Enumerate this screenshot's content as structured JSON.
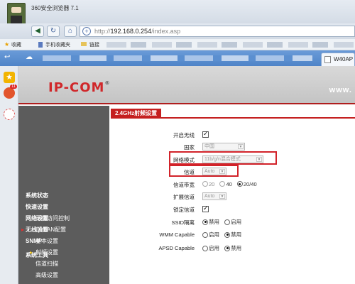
{
  "browser": {
    "title": "360安全浏览器 7.1",
    "url_prefix": "http://",
    "url_host": "192.168.0.254",
    "url_path": "/index.asp",
    "bookmarks_label": "收藏",
    "bookmark_mobile": "手机收藏夹",
    "bookmark_link": "链接",
    "active_tab": "W40AP",
    "weibo_badge": "11"
  },
  "router": {
    "logo": "IP-COM",
    "logo_tm": "®",
    "site_text": "www."
  },
  "menu": {
    "items": [
      {
        "label": "系统状态"
      },
      {
        "label": "快速设置"
      },
      {
        "label": "网络设置"
      },
      {
        "label": "无线设置"
      },
      {
        "label": "基本设置"
      },
      {
        "label": "射频设置"
      },
      {
        "label": "信道扫描"
      },
      {
        "label": "高级设置"
      },
      {
        "label": "无线访问控制"
      },
      {
        "label": "QVLAN配置"
      },
      {
        "label": "SNMP"
      },
      {
        "label": "系统工具"
      }
    ]
  },
  "rf_settings": {
    "section_title": "2.4GHz射频设置",
    "enable_wireless": {
      "label": "开启无线",
      "checked": true
    },
    "country": {
      "label": "国家",
      "value": "中国"
    },
    "network_mode": {
      "label": "网络模式",
      "value": "11b/g/n混合模式"
    },
    "channel": {
      "label": "信道",
      "value": "Auto"
    },
    "bandwidth": {
      "label": "信道带宽",
      "options": [
        "20",
        "40",
        "20/40"
      ],
      "selected": "20/40"
    },
    "ext_channel": {
      "label": "扩展信道",
      "value": "Auto"
    },
    "lock_channel": {
      "label": "锁定信道",
      "checked": true
    },
    "ssid_isolation": {
      "label": "SSID隔离",
      "options": [
        "禁用",
        "启用"
      ],
      "selected": "禁用"
    },
    "wmm": {
      "label": "WMM Capable",
      "options": [
        "启用",
        "禁用"
      ],
      "selected": "禁用"
    },
    "apsd": {
      "label": "APSD Capable",
      "options": [
        "启用",
        "禁用"
      ],
      "selected": "禁用"
    }
  },
  "colors": {
    "brand_red": "#d0272a",
    "menu_bg": "#5c5c5c",
    "highlight": "#d2232a"
  }
}
